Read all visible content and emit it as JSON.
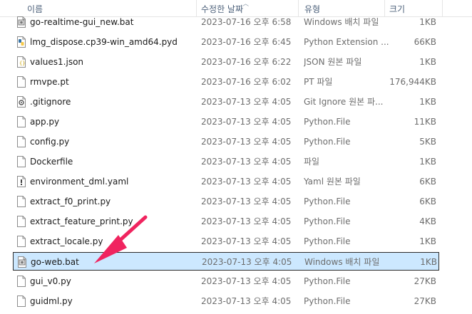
{
  "columns": {
    "name": "이름",
    "date": "수정한 날짜",
    "type": "유형",
    "size": "크기"
  },
  "colors": {
    "selected_bg": "#cce8ff",
    "selected_border": "#2b2b2b",
    "arrow": "#f0245f"
  },
  "rows": [
    {
      "name": "go-realtime-gui_new.bat",
      "date": "2023-07-16 오후 6:58",
      "type": "Windows 배치 파일",
      "size": "1KB",
      "icon": "bat-file-icon"
    },
    {
      "name": "lmg_dispose.cp39-win_amd64.pyd",
      "date": "2023-07-16 오후 6:45",
      "type": "Python Extension ...",
      "size": "66KB",
      "icon": "python-file-icon"
    },
    {
      "name": "values1.json",
      "date": "2023-07-16 오후 6:22",
      "type": "JSON 원본 파일",
      "size": "1KB",
      "icon": "json-file-icon"
    },
    {
      "name": "rmvpe.pt",
      "date": "2023-07-16 오후 6:02",
      "type": "PT 파일",
      "size": "176,944KB",
      "icon": "file-icon"
    },
    {
      "name": ".gitignore",
      "date": "2023-07-13 오후 4:05",
      "type": "Git Ignore 원본 파...",
      "size": "1KB",
      "icon": "gear-file-icon"
    },
    {
      "name": "app.py",
      "date": "2023-07-13 오후 4:05",
      "type": "Python.File",
      "size": "11KB",
      "icon": "file-icon"
    },
    {
      "name": "config.py",
      "date": "2023-07-13 오후 4:05",
      "type": "Python.File",
      "size": "5KB",
      "icon": "file-icon"
    },
    {
      "name": "Dockerfile",
      "date": "2023-07-13 오후 4:05",
      "type": "파일",
      "size": "1KB",
      "icon": "file-icon"
    },
    {
      "name": "environment_dml.yaml",
      "date": "2023-07-13 오후 4:05",
      "type": "Yaml 원본 파일",
      "size": "6KB",
      "icon": "yaml-file-icon"
    },
    {
      "name": "extract_f0_print.py",
      "date": "2023-07-13 오후 4:05",
      "type": "Python.File",
      "size": "6KB",
      "icon": "file-icon"
    },
    {
      "name": "extract_feature_print.py",
      "date": "2023-07-13 오후 4:05",
      "type": "Python.File",
      "size": "4KB",
      "icon": "file-icon"
    },
    {
      "name": "extract_locale.py",
      "date": "2023-07-13 오후 4:05",
      "type": "Python.File",
      "size": "1KB",
      "icon": "file-icon"
    },
    {
      "name": "go-web.bat",
      "date": "2023-07-13 오후 4:05",
      "type": "Windows 배치 파일",
      "size": "1KB",
      "icon": "bat-file-icon",
      "selected": true
    },
    {
      "name": "gui_v0.py",
      "date": "2023-07-13 오후 4:05",
      "type": "Python.File",
      "size": "27KB",
      "icon": "file-icon"
    },
    {
      "name": "guidml.py",
      "date": "2023-07-13 오후 4:05",
      "type": "Python.File",
      "size": "27KB",
      "icon": "file-icon"
    }
  ]
}
